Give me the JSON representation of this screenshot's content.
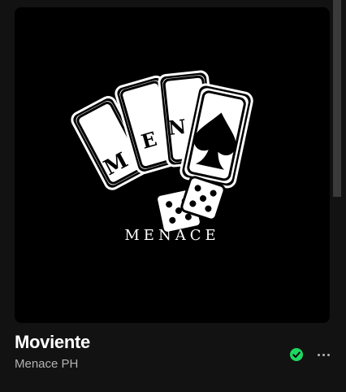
{
  "track": {
    "title": "Moviente",
    "artist": "Menace PH"
  },
  "cover": {
    "logo_cards_text": "MEN",
    "logo_wordmark": "MENACE",
    "background_color": "#000000"
  },
  "icons": {
    "saved": "check-circle-icon",
    "more": "more-options-icon"
  },
  "colors": {
    "accent": "#1ed760",
    "panel_bg": "#121212",
    "text_primary": "#ffffff",
    "text_secondary": "#b3b3b3"
  }
}
